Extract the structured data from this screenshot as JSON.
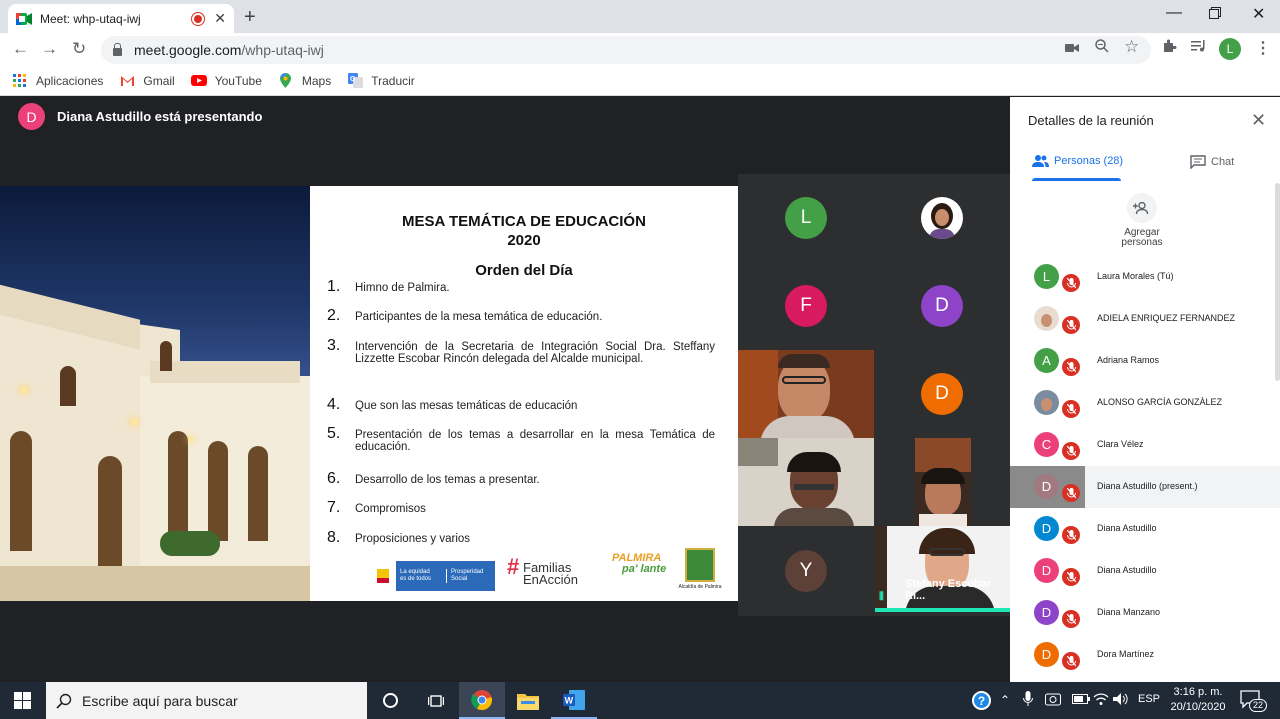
{
  "browser": {
    "tab_title": "Meet: whp-utaq-iwj",
    "url_host": "meet.google.com",
    "url_path": "/whp-utaq-iwj",
    "profile_initial": "L",
    "bookmarks": [
      {
        "label": "Aplicaciones",
        "icon": "apps-grid-icon"
      },
      {
        "label": "Gmail",
        "icon": "gmail-icon"
      },
      {
        "label": "YouTube",
        "icon": "youtube-icon"
      },
      {
        "label": "Maps",
        "icon": "maps-pin-icon"
      },
      {
        "label": "Traducir",
        "icon": "translate-icon"
      }
    ]
  },
  "meet": {
    "presenter_initial": "D",
    "presenter_text": "Diana Astudillo está presentando",
    "slide": {
      "title_line1": "MESA TEMÁTICA DE EDUCACIÓN",
      "title_line2": "2020",
      "subtitle": "Orden del Día",
      "agenda": [
        {
          "num": "1.",
          "text": "Himno de Palmira."
        },
        {
          "num": "2.",
          "text": "Participantes de la mesa temática de educación."
        },
        {
          "num": "3.",
          "text": "Intervención de la Secretaria de Integración Social Dra. Steffany Lizzette Escobar Rincón delegada del Alcalde municipal."
        },
        {
          "num": "4.",
          "text": "Que son las mesas temáticas de educación"
        },
        {
          "num": "5.",
          "text": "Presentación de los temas a desarrollar en la mesa Temática de educación."
        },
        {
          "num": "6.",
          "text": "Desarrollo de los temas a presentar."
        },
        {
          "num": "7.",
          "text": "Compromisos"
        },
        {
          "num": "8.",
          "text": "Proposiciones y varios"
        }
      ],
      "logos": {
        "gov_line1": "La equidad",
        "gov_line2": "es de todos",
        "gov_right1": "Prosperidad",
        "gov_right2": "Social",
        "familias1": "Familias",
        "familias2": "EnAcción",
        "palmira1": "PALMIRA",
        "palmira2": "pa' lante",
        "alcaldia": "Alcaldía de Palmira"
      }
    },
    "tiles": [
      {
        "initial": "L",
        "color": "#43a047"
      },
      {
        "initial": "F",
        "color": "#d81b60"
      },
      {
        "initial": "D",
        "color": "#8e44c8"
      },
      {
        "initial": "D",
        "color": "#ef6c00"
      },
      {
        "initial": "Y",
        "color": "#5d4037"
      }
    ],
    "self_view_name": "Stefany Escobar Ri..."
  },
  "sidebar": {
    "title": "Detalles de la reunión",
    "tab_people": "Personas (28)",
    "tab_chat": "Chat",
    "add_line1": "Agregar",
    "add_line2": "personas",
    "participants": [
      {
        "initial": "L",
        "color": "#43a047",
        "name": "Laura Morales (Tú)"
      },
      {
        "initial": "",
        "color": "#e8dcd0",
        "name": "ADIELA ENRIQUEZ FERNANDEZ"
      },
      {
        "initial": "A",
        "color": "#43a047",
        "name": "Adriana Ramos"
      },
      {
        "initial": "",
        "color": "#7a8ca0",
        "name": "ALONSO GARCÍA GONZÀLEZ"
      },
      {
        "initial": "C",
        "color": "#ec407a",
        "name": "Clara Vélez"
      },
      {
        "initial": "D",
        "color": "#a07a80",
        "name": "Diana Astudillo (present.)"
      },
      {
        "initial": "D",
        "color": "#0288d1",
        "name": "Diana Astudillo"
      },
      {
        "initial": "D",
        "color": "#ec407a",
        "name": "Diana Astudillo"
      },
      {
        "initial": "D",
        "color": "#8e44c8",
        "name": "Diana Manzano"
      },
      {
        "initial": "D",
        "color": "#ef6c00",
        "name": "Dora Martínez"
      }
    ]
  },
  "taskbar": {
    "search_placeholder": "Escribe aquí para buscar",
    "lang": "ESP",
    "time": "3:16 p. m.",
    "date": "20/10/2020",
    "notif_count": "22"
  }
}
